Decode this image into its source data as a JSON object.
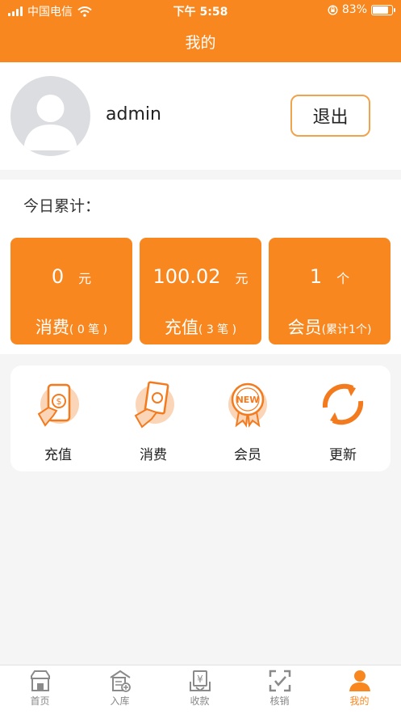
{
  "status_bar": {
    "carrier": "中国电信",
    "time": "下午 5:58",
    "battery": "83%",
    "battery_level": 0.83
  },
  "header": {
    "title": "我的"
  },
  "profile": {
    "username": "admin",
    "logout_label": "退出"
  },
  "today": {
    "title": "今日累计：",
    "cards": [
      {
        "value": "0",
        "unit": "元",
        "label": "消费",
        "note": "( 0 笔 )"
      },
      {
        "value": "100.02",
        "unit": "元",
        "label": "充值",
        "note": "( 3 笔 )"
      },
      {
        "value": "1",
        "unit": "个",
        "label": "会员",
        "note": "(累计1个)"
      }
    ]
  },
  "shortcuts": [
    {
      "label": "充值",
      "icon": "phone-payment-icon"
    },
    {
      "label": "消费",
      "icon": "hand-cash-icon"
    },
    {
      "label": "会员",
      "icon": "new-badge-icon"
    },
    {
      "label": "更新",
      "icon": "refresh-icon"
    }
  ],
  "tabbar": {
    "items": [
      {
        "label": "首页",
        "icon": "store-icon"
      },
      {
        "label": "入库",
        "icon": "warehouse-icon"
      },
      {
        "label": "收款",
        "icon": "yuan-receipt-icon"
      },
      {
        "label": "核销",
        "icon": "scan-check-icon"
      },
      {
        "label": "我的",
        "icon": "user-icon"
      }
    ],
    "active_index": 4
  },
  "colors": {
    "accent": "#f7871e",
    "icon_light": "#fbd5b8",
    "inactive": "#888888"
  }
}
